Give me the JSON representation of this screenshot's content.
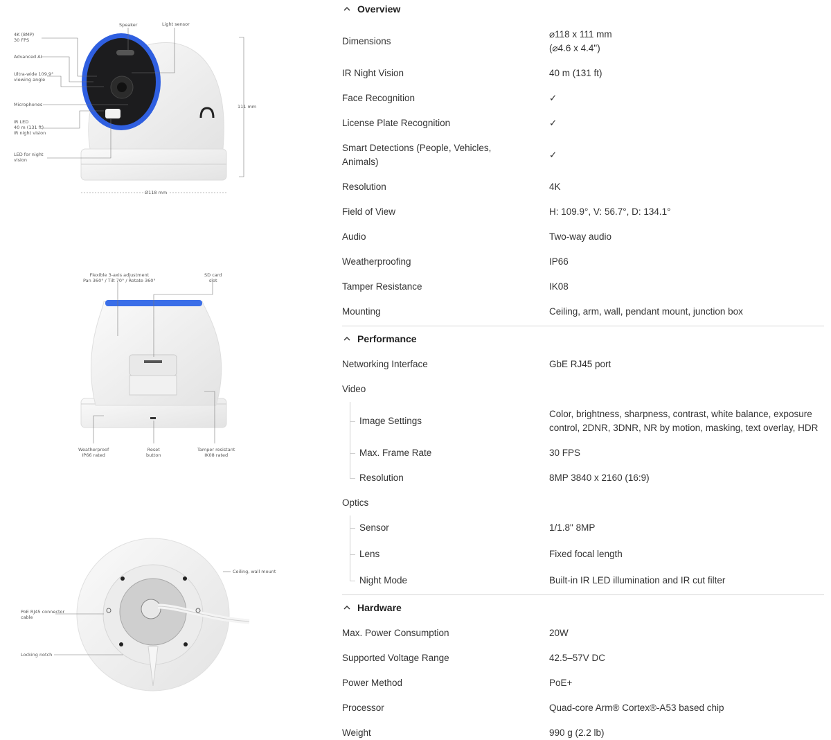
{
  "figures": {
    "front": {
      "labels": {
        "speaker": "Speaker",
        "light_sensor": "Light sensor",
        "res": "4K (8MP)\n30 FPS",
        "ai": "Advanced AI",
        "angle": "Ultra-wide 109.9°\nviewing angle",
        "mics": "Microphones",
        "irled": "IR LED\n40 m (131 ft)\nIR night vision",
        "led": "LED for night\nvision",
        "height": "111 mm",
        "diameter": "Ø118 mm"
      }
    },
    "back": {
      "labels": {
        "adjust": "Flexible 3-axis adjustment\nPan 360° / Tilt 70° / Rotate 360°",
        "sd": "SD card\nslot",
        "weather": "Weatherproof\nIP66 rated",
        "reset": "Reset\nbutton",
        "tamper": "Tamper resistant\nIK08 rated"
      }
    },
    "bottom": {
      "labels": {
        "mount": "Ceiling, wall mount",
        "poe": "PoE RJ45 connector\ncable",
        "notch": "Locking notch"
      }
    }
  },
  "sections": [
    {
      "title": "Overview",
      "rows": [
        {
          "key": "Dimensions",
          "value": "⌀118 x 111 mm\n(⌀4.6 x 4.4\")"
        },
        {
          "key": "IR Night Vision",
          "value": "40 m (131 ft)"
        },
        {
          "key": "Face Recognition",
          "value": "✓"
        },
        {
          "key": "License Plate Recognition",
          "value": "✓"
        },
        {
          "key": "Smart Detections (People, Vehicles, Animals)",
          "value": "✓"
        },
        {
          "key": "Resolution",
          "value": "4K"
        },
        {
          "key": "Field of View",
          "value": "H: 109.9°, V: 56.7°, D: 134.1°"
        },
        {
          "key": "Audio",
          "value": "Two-way audio"
        },
        {
          "key": "Weatherproofing",
          "value": "IP66"
        },
        {
          "key": "Tamper Resistance",
          "value": "IK08"
        },
        {
          "key": "Mounting",
          "value": "Ceiling, arm, wall, pendant mount, junction box"
        }
      ]
    },
    {
      "title": "Performance",
      "rows": [
        {
          "key": "Networking Interface",
          "value": "GbE RJ45 port"
        },
        {
          "key": "Video",
          "value": ""
        },
        {
          "key": "Image Settings",
          "value": "Color, brightness, sharpness, contrast, white balance, exposure control, 2DNR, 3DNR, NR by motion, masking, text overlay, HDR"
        },
        {
          "key": "Max. Frame Rate",
          "value": "30 FPS"
        },
        {
          "key": "Resolution",
          "value": "8MP 3840 x 2160 (16:9)"
        },
        {
          "key": "Optics",
          "value": ""
        },
        {
          "key": "Sensor",
          "value": "1/1.8\" 8MP"
        },
        {
          "key": "Lens",
          "value": "Fixed focal length"
        },
        {
          "key": "Night Mode",
          "value": "Built-in IR LED illumination and IR cut filter"
        }
      ]
    },
    {
      "title": "Hardware",
      "rows": [
        {
          "key": "Max. Power Consumption",
          "value": "20W"
        },
        {
          "key": "Supported Voltage Range",
          "value": "42.5–57V DC"
        },
        {
          "key": "Power Method",
          "value": "PoE+"
        },
        {
          "key": "Processor",
          "value": "Quad-core Arm® Cortex®-A53 based chip"
        },
        {
          "key": "Weight",
          "value": "990 g (2.2 lb)"
        }
      ]
    }
  ],
  "colors": {
    "accent_ring": "#3a6ee8",
    "text": "#333333",
    "divider": "#d6d6d6"
  },
  "icons": {
    "section_toggle": "chevron-up-icon",
    "check": "check-mark"
  }
}
